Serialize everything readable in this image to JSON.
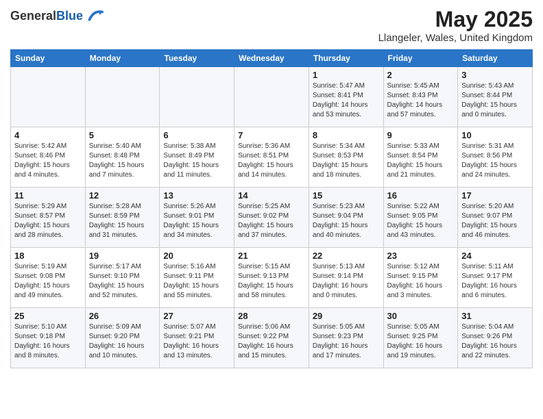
{
  "header": {
    "logo_line1": "General",
    "logo_line2": "Blue",
    "month_title": "May 2025",
    "location": "Llangeler, Wales, United Kingdom"
  },
  "days_of_week": [
    "Sunday",
    "Monday",
    "Tuesday",
    "Wednesday",
    "Thursday",
    "Friday",
    "Saturday"
  ],
  "weeks": [
    [
      {
        "day": "",
        "info": ""
      },
      {
        "day": "",
        "info": ""
      },
      {
        "day": "",
        "info": ""
      },
      {
        "day": "",
        "info": ""
      },
      {
        "day": "1",
        "info": "Sunrise: 5:47 AM\nSunset: 8:41 PM\nDaylight: 14 hours\nand 53 minutes."
      },
      {
        "day": "2",
        "info": "Sunrise: 5:45 AM\nSunset: 8:43 PM\nDaylight: 14 hours\nand 57 minutes."
      },
      {
        "day": "3",
        "info": "Sunrise: 5:43 AM\nSunset: 8:44 PM\nDaylight: 15 hours\nand 0 minutes."
      }
    ],
    [
      {
        "day": "4",
        "info": "Sunrise: 5:42 AM\nSunset: 8:46 PM\nDaylight: 15 hours\nand 4 minutes."
      },
      {
        "day": "5",
        "info": "Sunrise: 5:40 AM\nSunset: 8:48 PM\nDaylight: 15 hours\nand 7 minutes."
      },
      {
        "day": "6",
        "info": "Sunrise: 5:38 AM\nSunset: 8:49 PM\nDaylight: 15 hours\nand 11 minutes."
      },
      {
        "day": "7",
        "info": "Sunrise: 5:36 AM\nSunset: 8:51 PM\nDaylight: 15 hours\nand 14 minutes."
      },
      {
        "day": "8",
        "info": "Sunrise: 5:34 AM\nSunset: 8:53 PM\nDaylight: 15 hours\nand 18 minutes."
      },
      {
        "day": "9",
        "info": "Sunrise: 5:33 AM\nSunset: 8:54 PM\nDaylight: 15 hours\nand 21 minutes."
      },
      {
        "day": "10",
        "info": "Sunrise: 5:31 AM\nSunset: 8:56 PM\nDaylight: 15 hours\nand 24 minutes."
      }
    ],
    [
      {
        "day": "11",
        "info": "Sunrise: 5:29 AM\nSunset: 8:57 PM\nDaylight: 15 hours\nand 28 minutes."
      },
      {
        "day": "12",
        "info": "Sunrise: 5:28 AM\nSunset: 8:59 PM\nDaylight: 15 hours\nand 31 minutes."
      },
      {
        "day": "13",
        "info": "Sunrise: 5:26 AM\nSunset: 9:01 PM\nDaylight: 15 hours\nand 34 minutes."
      },
      {
        "day": "14",
        "info": "Sunrise: 5:25 AM\nSunset: 9:02 PM\nDaylight: 15 hours\nand 37 minutes."
      },
      {
        "day": "15",
        "info": "Sunrise: 5:23 AM\nSunset: 9:04 PM\nDaylight: 15 hours\nand 40 minutes."
      },
      {
        "day": "16",
        "info": "Sunrise: 5:22 AM\nSunset: 9:05 PM\nDaylight: 15 hours\nand 43 minutes."
      },
      {
        "day": "17",
        "info": "Sunrise: 5:20 AM\nSunset: 9:07 PM\nDaylight: 15 hours\nand 46 minutes."
      }
    ],
    [
      {
        "day": "18",
        "info": "Sunrise: 5:19 AM\nSunset: 9:08 PM\nDaylight: 15 hours\nand 49 minutes."
      },
      {
        "day": "19",
        "info": "Sunrise: 5:17 AM\nSunset: 9:10 PM\nDaylight: 15 hours\nand 52 minutes."
      },
      {
        "day": "20",
        "info": "Sunrise: 5:16 AM\nSunset: 9:11 PM\nDaylight: 15 hours\nand 55 minutes."
      },
      {
        "day": "21",
        "info": "Sunrise: 5:15 AM\nSunset: 9:13 PM\nDaylight: 15 hours\nand 58 minutes."
      },
      {
        "day": "22",
        "info": "Sunrise: 5:13 AM\nSunset: 9:14 PM\nDaylight: 16 hours\nand 0 minutes."
      },
      {
        "day": "23",
        "info": "Sunrise: 5:12 AM\nSunset: 9:15 PM\nDaylight: 16 hours\nand 3 minutes."
      },
      {
        "day": "24",
        "info": "Sunrise: 5:11 AM\nSunset: 9:17 PM\nDaylight: 16 hours\nand 6 minutes."
      }
    ],
    [
      {
        "day": "25",
        "info": "Sunrise: 5:10 AM\nSunset: 9:18 PM\nDaylight: 16 hours\nand 8 minutes."
      },
      {
        "day": "26",
        "info": "Sunrise: 5:09 AM\nSunset: 9:20 PM\nDaylight: 16 hours\nand 10 minutes."
      },
      {
        "day": "27",
        "info": "Sunrise: 5:07 AM\nSunset: 9:21 PM\nDaylight: 16 hours\nand 13 minutes."
      },
      {
        "day": "28",
        "info": "Sunrise: 5:06 AM\nSunset: 9:22 PM\nDaylight: 16 hours\nand 15 minutes."
      },
      {
        "day": "29",
        "info": "Sunrise: 5:05 AM\nSunset: 9:23 PM\nDaylight: 16 hours\nand 17 minutes."
      },
      {
        "day": "30",
        "info": "Sunrise: 5:05 AM\nSunset: 9:25 PM\nDaylight: 16 hours\nand 19 minutes."
      },
      {
        "day": "31",
        "info": "Sunrise: 5:04 AM\nSunset: 9:26 PM\nDaylight: 16 hours\nand 22 minutes."
      }
    ]
  ]
}
